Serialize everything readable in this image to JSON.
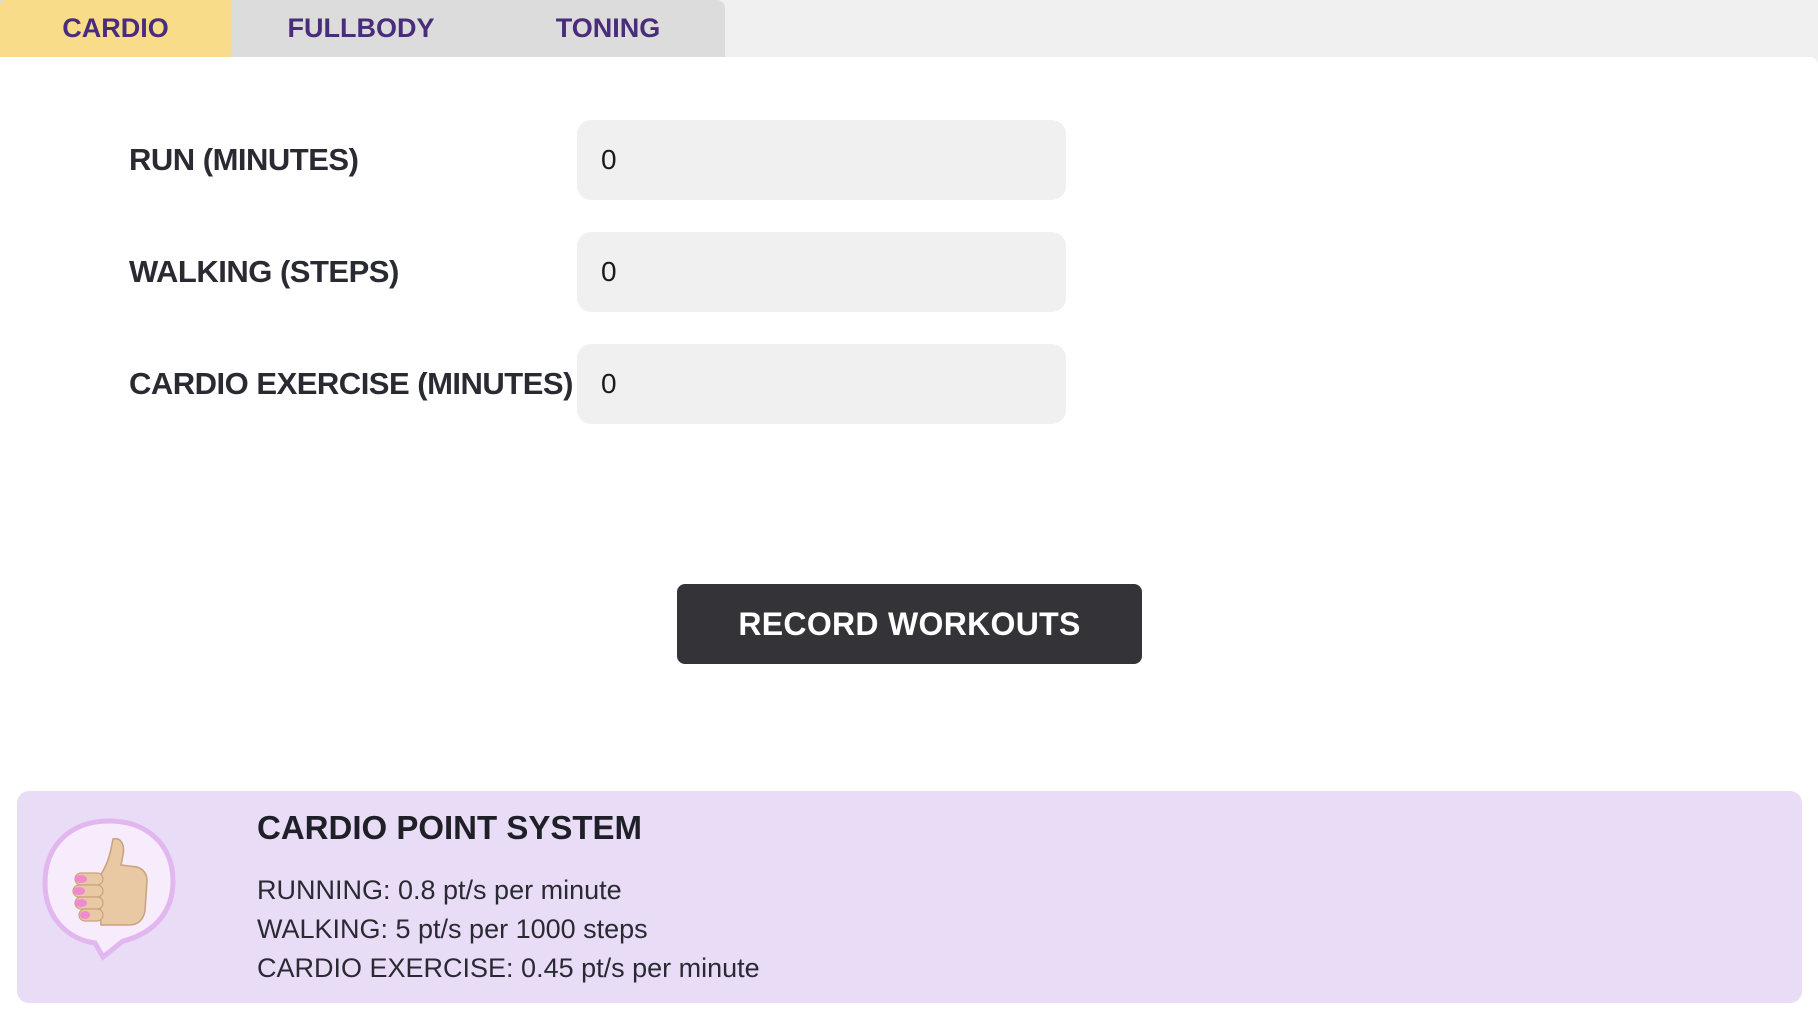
{
  "tabs": [
    {
      "label": "CARDIO",
      "active": true
    },
    {
      "label": "FULLBODY",
      "active": false
    },
    {
      "label": "TONING",
      "active": false
    }
  ],
  "form": {
    "rows": [
      {
        "label": "RUN (MINUTES)",
        "value": "0"
      },
      {
        "label": "WALKING (STEPS)",
        "value": "0"
      },
      {
        "label": "CARDIO EXERCISE (MINUTES)",
        "value": "0"
      }
    ]
  },
  "record_button": {
    "label": "RECORD WORKOUTS"
  },
  "info": {
    "icon": "thumbs-up-icon",
    "title": "CARDIO POINT SYSTEM",
    "lines": [
      "RUNNING: 0.8 pt/s per minute",
      "WALKING: 5 pt/s per 1000 steps",
      "CARDIO EXERCISE: 0.45 pt/s per minute"
    ]
  },
  "colors": {
    "active_tab": "#f9dc8a",
    "tab_text": "#4a2d7a",
    "button": "#333338",
    "info_bg": "#e9dcf6"
  }
}
